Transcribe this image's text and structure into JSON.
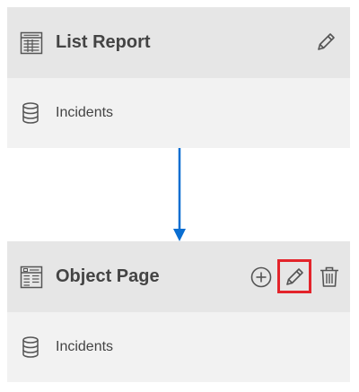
{
  "pages": {
    "list_report": {
      "title": "List Report",
      "entity": "Incidents",
      "icons": {
        "page": "table-icon",
        "entity": "database-icon",
        "edit": "pencil-icon"
      }
    },
    "object_page": {
      "title": "Object Page",
      "entity": "Incidents",
      "icons": {
        "page": "form-icon",
        "entity": "database-icon",
        "add": "plus-circle-icon",
        "edit": "pencil-icon",
        "delete": "trash-icon"
      }
    }
  },
  "colors": {
    "header_bg": "#e6e6e6",
    "body_bg": "#f2f2f2",
    "arrow": "#0a6ed1",
    "highlight": "#e3242b",
    "icon": "#555555"
  }
}
